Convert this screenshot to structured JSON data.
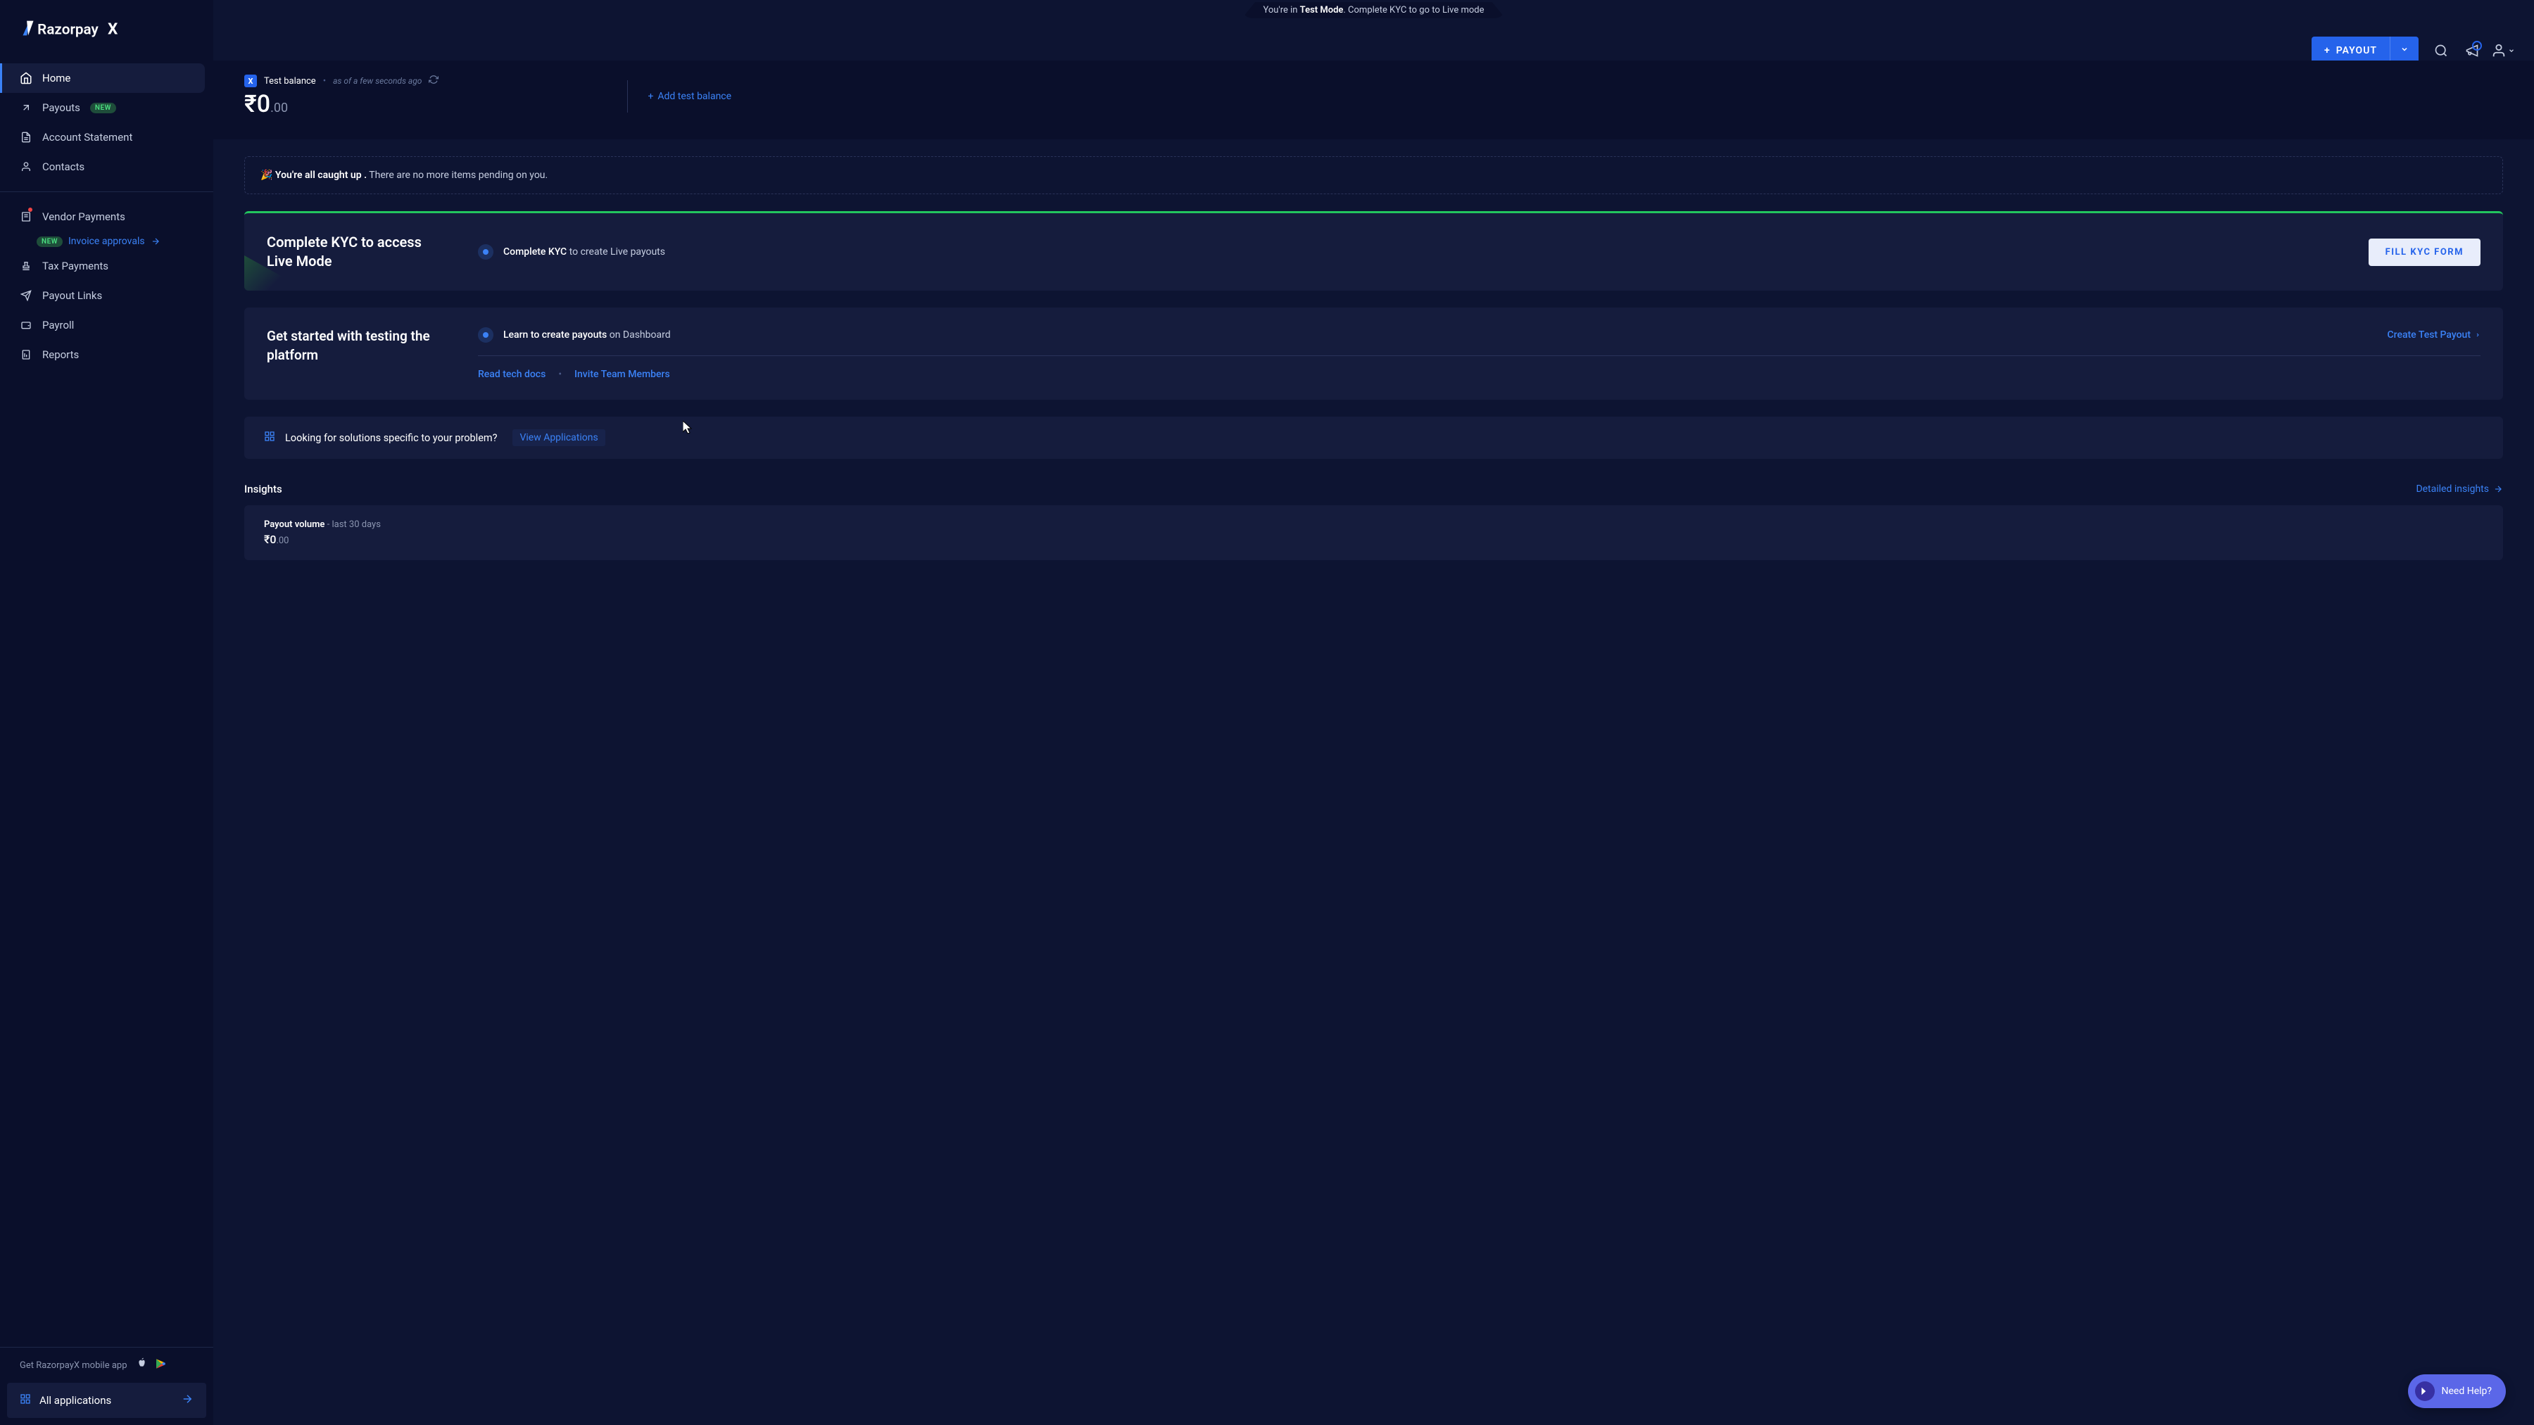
{
  "banner": {
    "prefix": "You're in ",
    "mode": "Test Mode",
    "suffix": ". Complete KYC to go to Live mode"
  },
  "logo": "RazorpayX",
  "sidebar": {
    "items": [
      {
        "label": "Home",
        "active": true
      },
      {
        "label": "Payouts",
        "badge": "NEW"
      },
      {
        "label": "Account Statement"
      },
      {
        "label": "Contacts"
      },
      {
        "label": "Vendor Payments",
        "dot": true
      },
      {
        "label": "Tax Payments"
      },
      {
        "label": "Payout Links"
      },
      {
        "label": "Payroll"
      },
      {
        "label": "Reports"
      }
    ],
    "invoice_sub": {
      "badge": "NEW",
      "label": "Invoice approvals"
    },
    "mobile_app": "Get RazorpayX mobile app",
    "all_apps": "All applications"
  },
  "topbar": {
    "payout_btn": "PAYOUT"
  },
  "balance": {
    "label": "Test balance",
    "time": "as of a few seconds ago",
    "currency": "₹",
    "whole": "0",
    "cents": ".00",
    "add_link": "Add test balance"
  },
  "notice": {
    "emoji": "🎉",
    "bold": "You're all caught up .",
    "rest": " There are no more items pending on you."
  },
  "kyc_card": {
    "title": "Complete KYC to access Live Mode",
    "mid_bold": "Complete KYC",
    "mid_rest": " to create Live payouts",
    "button": "FILL KYC FORM"
  },
  "start_card": {
    "title": "Get started with testing the platform",
    "row1_bold": "Learn to create payouts",
    "row1_rest": " on Dashboard",
    "row1_action": "Create Test Payout",
    "link1": "Read tech docs",
    "link2": "Invite Team Members"
  },
  "solutions": {
    "text": "Looking for solutions specific to your problem?",
    "link": "View Applications"
  },
  "insights": {
    "heading": "Insights",
    "detailed": "Detailed insights",
    "volume_label": "Payout volume",
    "volume_period": " - last 30 days",
    "amt_currency": "₹",
    "amt_whole": "0",
    "amt_cents": ".00"
  },
  "help": "Need Help?"
}
